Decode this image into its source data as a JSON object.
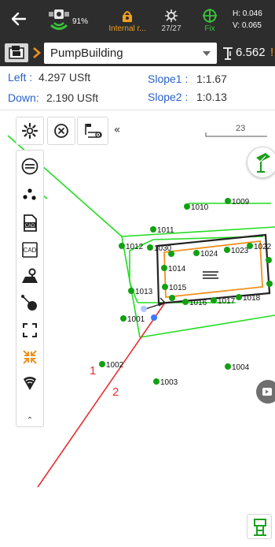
{
  "status": {
    "battery": "91%",
    "link_label": "Internal r...",
    "satellites": "27/27",
    "fix": "Fix",
    "h_value": "H: 0.046",
    "v_value": "V: 0.065"
  },
  "selector": {
    "point_name": "PumpBuilding",
    "height": "6.562",
    "height_cut": "!"
  },
  "offsets": {
    "left_label": "Left :",
    "left_value": "4.297 USft",
    "down_label": "Down:",
    "down_value": "2.190 USft",
    "slope1_label": "Slope1 :",
    "slope1_value": "1:1.67",
    "slope2_label": "Slope2 :",
    "slope2_value": "1:0.13"
  },
  "map": {
    "scale_label": "23",
    "line_labels": [
      "1",
      "2"
    ],
    "points": [
      "1001",
      "1002",
      "1003",
      "1004",
      "1009",
      "1010",
      "1011",
      "1012",
      "1013",
      "1014",
      "1015",
      "1016",
      "1017",
      "1018",
      "1022",
      "1023",
      "1024",
      "1030"
    ],
    "colors": {
      "toe_line": "#22dd22",
      "building": "#222222",
      "design_offset": "#f0901e",
      "stake_line": "#e53030",
      "point": "#12a012",
      "current": "#3a78ff"
    }
  },
  "toolbar": {
    "collapse_label": "«",
    "more_label": "⌃"
  },
  "icons": [
    "back-arrow-icon",
    "satellite-icon",
    "link-icon",
    "satellite-count-icon",
    "fix-crosshair-icon",
    "layers-icon",
    "settings-icon",
    "close-circle-icon",
    "gps-antenna-icon",
    "swap-icon",
    "points-icon",
    "cad-icon",
    "cad-frame-icon",
    "map-layer-icon",
    "stakeout-line-icon",
    "fullscreen-icon",
    "shrink-icon",
    "signal-icon",
    "stake-icon"
  ]
}
